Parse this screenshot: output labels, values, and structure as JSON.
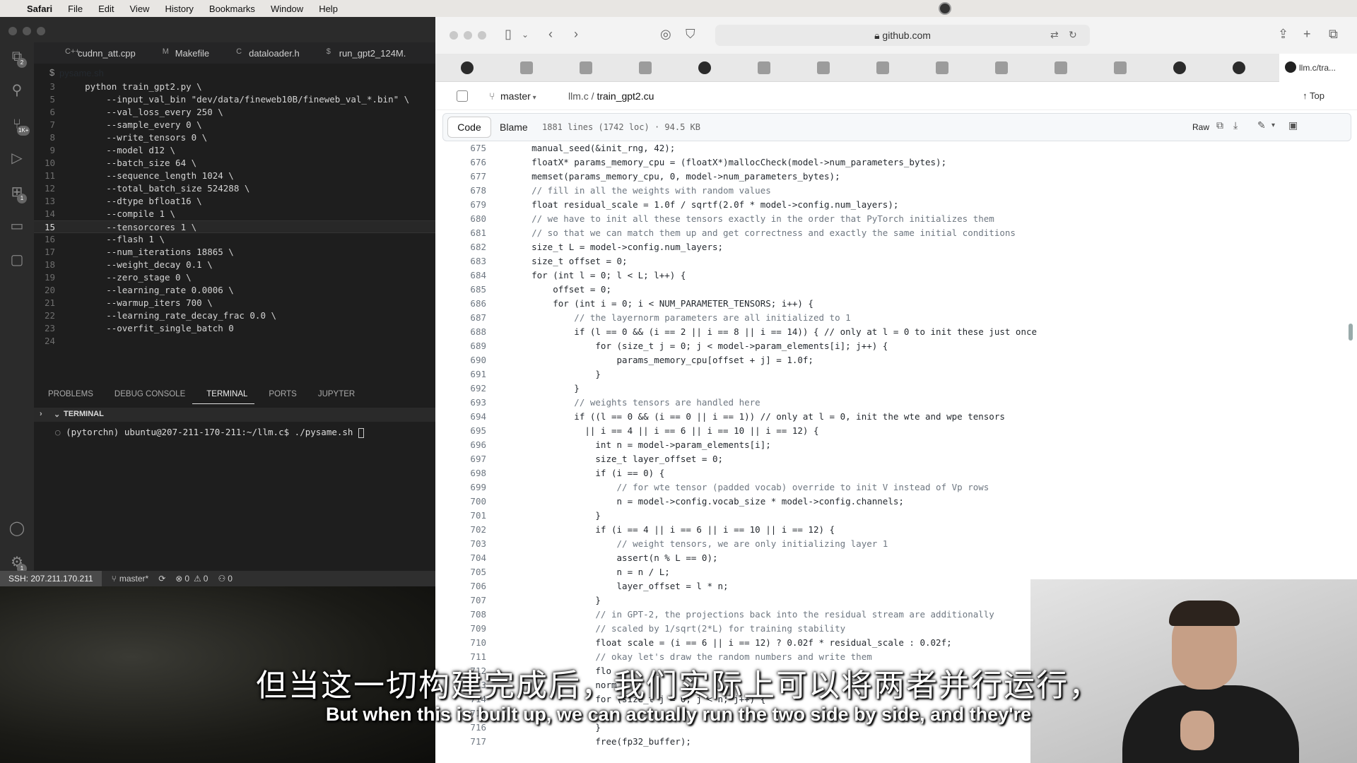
{
  "menubar": {
    "app": "Safari",
    "items": [
      "File",
      "Edit",
      "View",
      "History",
      "Bookmarks",
      "Window",
      "Help"
    ]
  },
  "vscode": {
    "tabs": [
      {
        "label": "cudnn_att.cpp",
        "icon": "C++"
      },
      {
        "label": "Makefile",
        "icon": "M"
      },
      {
        "label": "dataloader.h",
        "icon": "C"
      },
      {
        "label": "run_gpt2_124M.",
        "icon": "$"
      }
    ],
    "breadcrumb": "pysame.sh",
    "editor_lines": [
      {
        "n": "3",
        "t": "    python train_gpt2.py \\"
      },
      {
        "n": "5",
        "t": "        --input_val_bin \"dev/data/fineweb10B/fineweb_val_*.bin\" \\"
      },
      {
        "n": "6",
        "t": "        --val_loss_every 250 \\"
      },
      {
        "n": "7",
        "t": "        --sample_every 0 \\"
      },
      {
        "n": "8",
        "t": "        --write_tensors 0 \\"
      },
      {
        "n": "9",
        "t": "        --model d12 \\"
      },
      {
        "n": "10",
        "t": "        --batch_size 64 \\"
      },
      {
        "n": "11",
        "t": "        --sequence_length 1024 \\"
      },
      {
        "n": "12",
        "t": "        --total_batch_size 524288 \\"
      },
      {
        "n": "13",
        "t": "        --dtype bfloat16 \\"
      },
      {
        "n": "14",
        "t": "        --compile 1 \\"
      },
      {
        "n": "15",
        "t": "        --tensorcores 1 \\",
        "current": true
      },
      {
        "n": "16",
        "t": "        --flash 1 \\"
      },
      {
        "n": "17",
        "t": "        --num_iterations 18865 \\"
      },
      {
        "n": "18",
        "t": "        --weight_decay 0.1 \\"
      },
      {
        "n": "19",
        "t": "        --zero_stage 0 \\"
      },
      {
        "n": "20",
        "t": "        --learning_rate 0.0006 \\"
      },
      {
        "n": "21",
        "t": "        --warmup_iters 700 \\"
      },
      {
        "n": "22",
        "t": "        --learning_rate_decay_frac 0.0 \\"
      },
      {
        "n": "23",
        "t": "        --overfit_single_batch 0"
      },
      {
        "n": "24",
        "t": ""
      }
    ],
    "panel_tabs": [
      "PROBLEMS",
      "DEBUG CONSOLE",
      "TERMINAL",
      "PORTS",
      "JUPYTER"
    ],
    "active_panel_tab": "TERMINAL",
    "terminal_header": "TERMINAL",
    "terminal_prompt": "(pytorchn) ubuntu@207-211-170-211:~/llm.c$ ./pysame.sh ",
    "activity_badges": {
      "source_control": "2",
      "extensions": "1K+",
      "remote": "1",
      "settings": "1"
    },
    "statusbar": {
      "ssh": "SSH: 207.211.170.211",
      "branch": "master*",
      "errors": "0",
      "warnings": "0",
      "ports": "0"
    }
  },
  "safari": {
    "url": "github.com",
    "last_fav_tab": "llm.c/tra...",
    "branch": "master",
    "repo": "llm.c",
    "file": "train_gpt2.cu",
    "top_label": "Top",
    "code_tab": "Code",
    "blame_tab": "Blame",
    "file_info": "1881 lines (1742 loc) · 94.5 KB",
    "raw_label": "Raw",
    "code_lines": [
      {
        "n": "675",
        "t": "    manual_seed(&init_rng, 42);"
      },
      {
        "n": "676",
        "t": "    floatX* params_memory_cpu = (floatX*)mallocCheck(model->num_parameters_bytes);"
      },
      {
        "n": "677",
        "t": "    memset(params_memory_cpu, 0, model->num_parameters_bytes);"
      },
      {
        "n": "678",
        "t": "    // fill in all the weights with random values",
        "c": true
      },
      {
        "n": "679",
        "t": "    float residual_scale = 1.0f / sqrtf(2.0f * model->config.num_layers);"
      },
      {
        "n": "680",
        "t": "    // we have to init all these tensors exactly in the order that PyTorch initializes them",
        "c": true
      },
      {
        "n": "681",
        "t": "    // so that we can match them up and get correctness and exactly the same initial conditions",
        "c": true
      },
      {
        "n": "682",
        "t": "    size_t L = model->config.num_layers;"
      },
      {
        "n": "683",
        "t": "    size_t offset = 0;"
      },
      {
        "n": "684",
        "t": "    for (int l = 0; l < L; l++) {"
      },
      {
        "n": "685",
        "t": "        offset = 0;"
      },
      {
        "n": "686",
        "t": "        for (int i = 0; i < NUM_PARAMETER_TENSORS; i++) {"
      },
      {
        "n": "687",
        "t": "            // the layernorm parameters are all initialized to 1",
        "c": true
      },
      {
        "n": "688",
        "t": "            if (l == 0 && (i == 2 || i == 8 || i == 14)) { // only at l = 0 to init these just once"
      },
      {
        "n": "689",
        "t": "                for (size_t j = 0; j < model->param_elements[i]; j++) {"
      },
      {
        "n": "690",
        "t": "                    params_memory_cpu[offset + j] = 1.0f;"
      },
      {
        "n": "691",
        "t": "                }"
      },
      {
        "n": "692",
        "t": "            }"
      },
      {
        "n": "693",
        "t": "            // weights tensors are handled here",
        "c": true
      },
      {
        "n": "694",
        "t": "            if ((l == 0 && (i == 0 || i == 1)) // only at l = 0, init the wte and wpe tensors"
      },
      {
        "n": "695",
        "t": "              || i == 4 || i == 6 || i == 10 || i == 12) {"
      },
      {
        "n": "696",
        "t": "                int n = model->param_elements[i];"
      },
      {
        "n": "697",
        "t": "                size_t layer_offset = 0;"
      },
      {
        "n": "698",
        "t": "                if (i == 0) {"
      },
      {
        "n": "699",
        "t": "                    // for wte tensor (padded vocab) override to init V instead of Vp rows",
        "c": true
      },
      {
        "n": "700",
        "t": "                    n = model->config.vocab_size * model->config.channels;"
      },
      {
        "n": "701",
        "t": "                }"
      },
      {
        "n": "702",
        "t": "                if (i == 4 || i == 6 || i == 10 || i == 12) {"
      },
      {
        "n": "703",
        "t": "                    // weight tensors, we are only initializing layer 1",
        "c": true
      },
      {
        "n": "704",
        "t": "                    assert(n % L == 0);"
      },
      {
        "n": "705",
        "t": "                    n = n / L;"
      },
      {
        "n": "706",
        "t": "                    layer_offset = l * n;"
      },
      {
        "n": "707",
        "t": "                }"
      },
      {
        "n": "708",
        "t": "                // in GPT-2, the projections back into the residual stream are additionally",
        "c": true
      },
      {
        "n": "709",
        "t": "                // scaled by 1/sqrt(2*L) for training stability",
        "c": true
      },
      {
        "n": "710",
        "t": "                float scale = (i == 6 || i == 12) ? 0.02f * residual_scale : 0.02f;"
      },
      {
        "n": "711",
        "t": "                // okay let's draw the random numbers and write them",
        "c": true
      },
      {
        "n": "712",
        "t": "                flo"
      },
      {
        "n": "713",
        "t": "                norm"
      },
      {
        "n": "714",
        "t": "                for (size_t j = 0; j < n; j++) {"
      },
      {
        "n": "715",
        "t": ""
      },
      {
        "n": "716",
        "t": "                }"
      },
      {
        "n": "717",
        "t": "                free(fp32_buffer);"
      }
    ]
  },
  "subtitles": {
    "chinese": "但当这一切构建完成后，我们实际上可以将两者并行运行，",
    "english": "But when this is built up, we can actually run the two side by side, and they're"
  }
}
